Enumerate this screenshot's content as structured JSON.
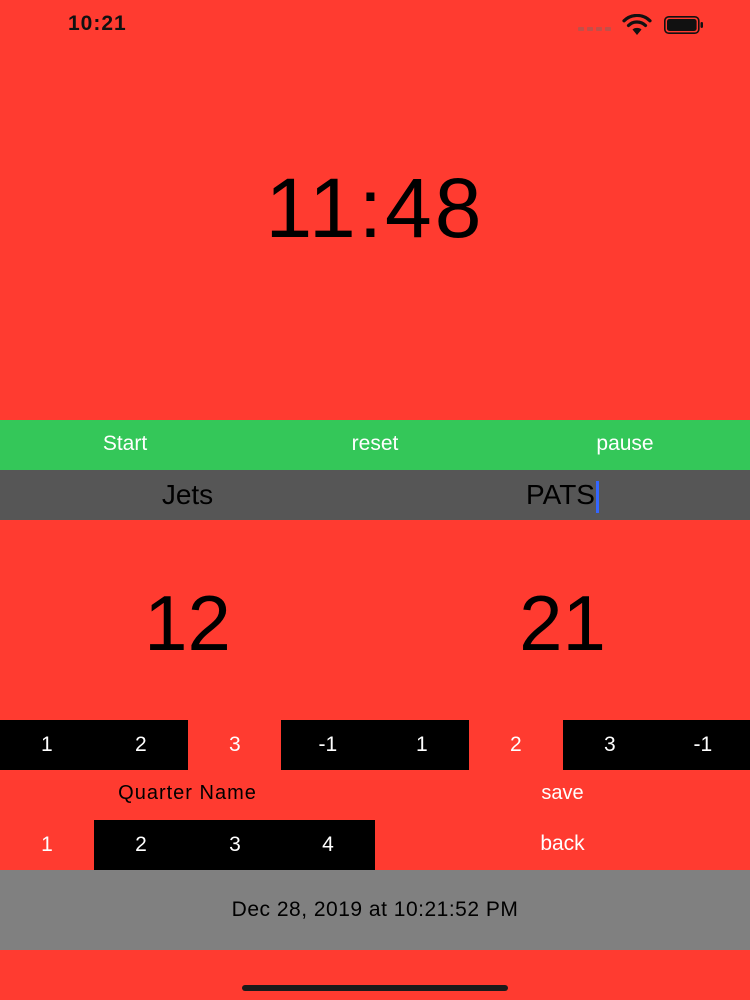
{
  "status_bar": {
    "time": "10:21"
  },
  "clock": {
    "value": "11:48"
  },
  "controls": {
    "start_label": "Start",
    "reset_label": "reset",
    "pause_label": "pause"
  },
  "teams": {
    "home": "Jets",
    "away": "PATS"
  },
  "scores": {
    "home": "12",
    "away": "21"
  },
  "home_increments": [
    "1",
    "2",
    "3",
    "-1"
  ],
  "away_increments": [
    "1",
    "2",
    "3",
    "-1"
  ],
  "quarter": {
    "label": "Quarter Name",
    "options": [
      "1",
      "2",
      "3",
      "4"
    ]
  },
  "actions": {
    "save_label": "save",
    "back_label": "back"
  },
  "timestamp": "Dec 28, 2019 at 10:21:52 PM",
  "colors": {
    "background": "#ff3b30",
    "controls_bar": "#34c759",
    "teams_bar": "#565656",
    "date_bar": "#808080",
    "cursor": "#3366ff"
  }
}
